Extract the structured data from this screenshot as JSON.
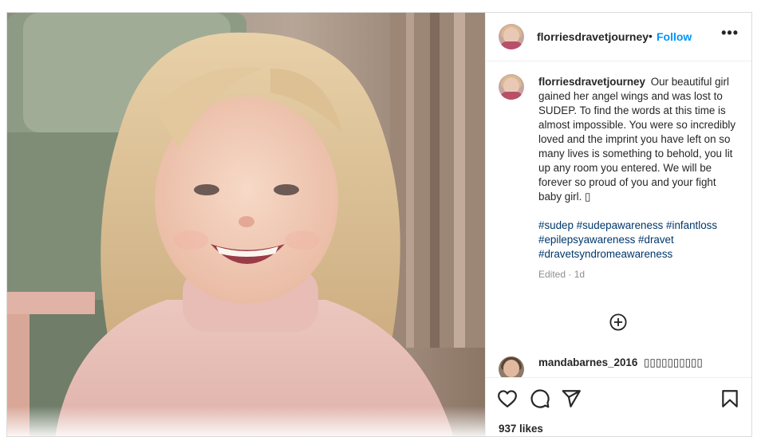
{
  "post": {
    "username": "florriesdravetjourney",
    "dot": "•",
    "follow_label": "Follow",
    "more_label": "•••",
    "caption": "Our beautiful girl gained her angel wings and was lost to SUDEP. To find the words at this time is almost impossible. You were so incredibly loved and the imprint you have left on so many lives is something to behold, you lit up any room you entered. We will be forever so proud of you and your fight baby girl. ▯",
    "hashtags": "#sudep #sudepawareness #infantloss #epilepsyawareness #dravet #dravetsyndromeawareness",
    "edited": "Edited · 1d",
    "likes": "937 likes"
  },
  "comment": {
    "username": "mandabarnes_2016",
    "text": "▯▯▯▯▯▯▯▯▯▯"
  },
  "icons": {
    "add_comments": "plus-circle-icon",
    "like": "heart-icon",
    "comment": "comment-icon",
    "share": "paper-plane-icon",
    "save": "bookmark-icon",
    "more": "more-horizontal-icon"
  },
  "colors": {
    "follow": "#0095f6",
    "hashtag": "#00376b",
    "muted": "#8e8e8e",
    "text": "#262626"
  }
}
